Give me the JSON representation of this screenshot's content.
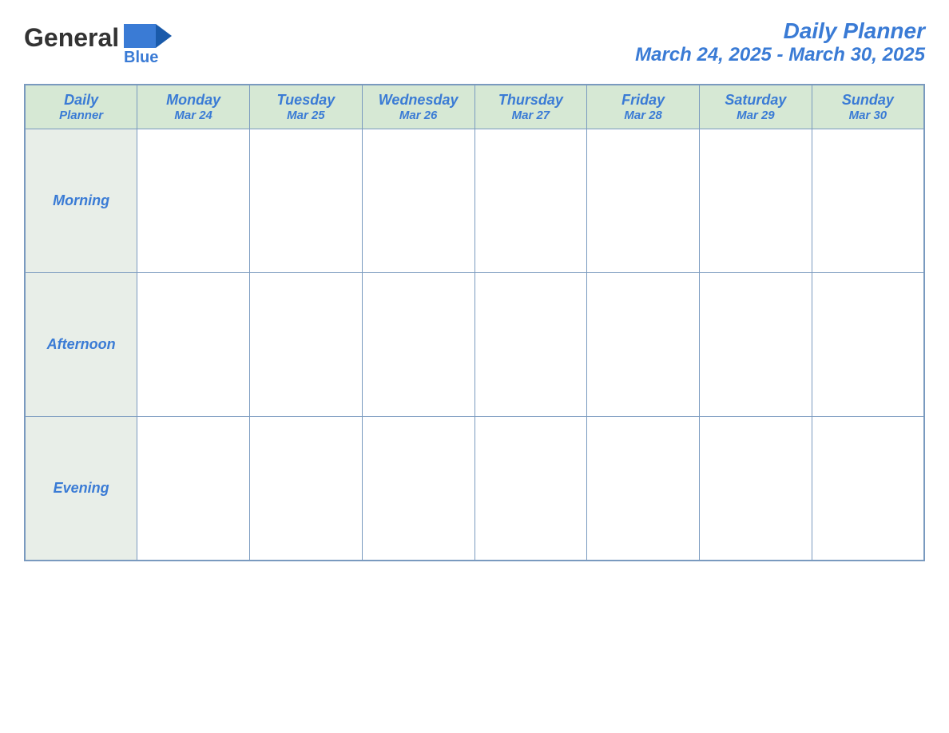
{
  "header": {
    "logo": {
      "text_general": "General",
      "text_blue": "Blue"
    },
    "title": "Daily Planner",
    "date_range": "March 24, 2025 - March 30, 2025"
  },
  "table": {
    "label_column": {
      "header_line1": "Daily",
      "header_line2": "Planner",
      "rows": [
        "Morning",
        "Afternoon",
        "Evening"
      ]
    },
    "days": [
      {
        "name": "Monday",
        "date": "Mar 24"
      },
      {
        "name": "Tuesday",
        "date": "Mar 25"
      },
      {
        "name": "Wednesday",
        "date": "Mar 26"
      },
      {
        "name": "Thursday",
        "date": "Mar 27"
      },
      {
        "name": "Friday",
        "date": "Mar 28"
      },
      {
        "name": "Saturday",
        "date": "Mar 29"
      },
      {
        "name": "Sunday",
        "date": "Mar 30"
      }
    ]
  }
}
